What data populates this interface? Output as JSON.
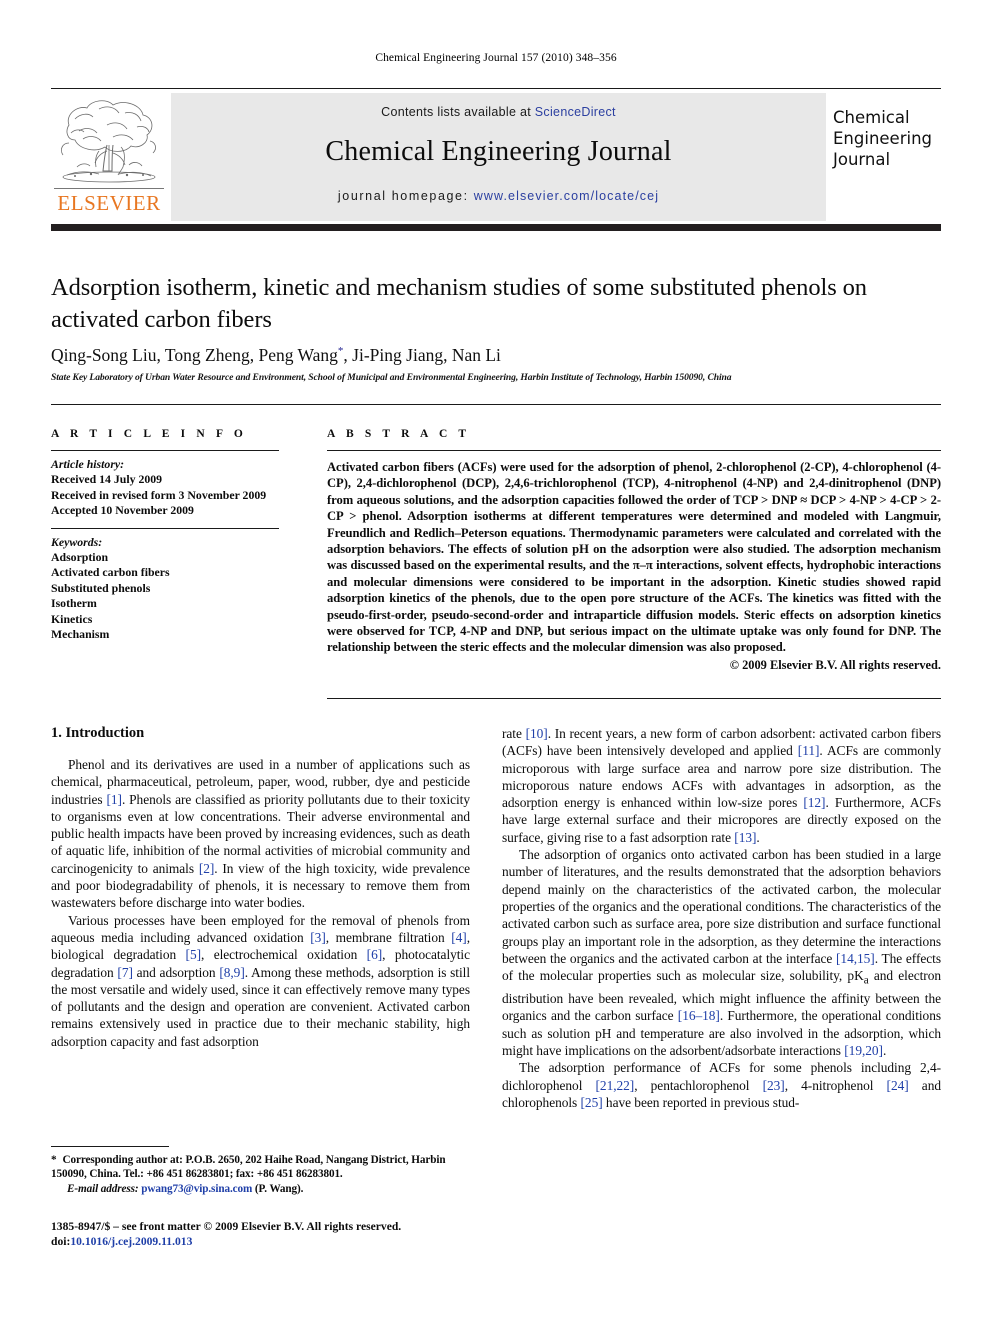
{
  "running_head": "Chemical Engineering Journal 157 (2010) 348–356",
  "masthead": {
    "contents_prefix": "Contents lists available at ",
    "sciencedirect": "ScienceDirect",
    "journal_title": "Chemical Engineering Journal",
    "homepage_prefix": "journal homepage:",
    "homepage_url": "www.elsevier.com/locate/cej",
    "publisher": "ELSEVIER",
    "cover_title": "Chemical\nEngineering\nJournal",
    "cover_line1": "Chemical",
    "cover_line2": "Engineering",
    "cover_line3": "Journal",
    "link_color": "#2b3fa0",
    "elsevier_orange": "#E87722",
    "band_color": "#e8e8e8"
  },
  "article": {
    "title": "Adsorption isotherm, kinetic and mechanism studies of some substituted phenols on activated carbon fibers",
    "authors": "Qing-Song Liu, Tong Zheng, Peng Wang",
    "authors_tail": ", Ji-Ping Jiang, Nan Li",
    "corresponding_marker": "*",
    "affiliation": "State Key Laboratory of Urban Water Resource and Environment, School of Municipal and Environmental Engineering, Harbin Institute of Technology, Harbin 150090, China"
  },
  "article_info": {
    "heading": "A R T I C L E   I N F O",
    "history_label": "Article history:",
    "history": [
      "Received 14 July 2009",
      "Received in revised form 3 November 2009",
      "Accepted 10 November 2009"
    ],
    "keywords_label": "Keywords:",
    "keywords": [
      "Adsorption",
      "Activated carbon fibers",
      "Substituted phenols",
      "Isotherm",
      "Kinetics",
      "Mechanism"
    ]
  },
  "abstract": {
    "heading": "A B S T R A C T",
    "text": "Activated carbon fibers (ACFs) were used for the adsorption of phenol, 2-chlorophenol (2-CP), 4-chlorophenol (4-CP), 2,4-dichlorophenol (DCP), 2,4,6-trichlorophenol (TCP), 4-nitrophenol (4-NP) and 2,4-dinitrophenol (DNP) from aqueous solutions, and the adsorption capacities followed the order of TCP > DNP ≈ DCP > 4-NP > 4-CP > 2-CP > phenol. Adsorption isotherms at different temperatures were determined and modeled with Langmuir, Freundlich and Redlich–Peterson equations. Thermodynamic parameters were calculated and correlated with the adsorption behaviors. The effects of solution pH on the adsorption were also studied. The adsorption mechanism was discussed based on the experimental results, and the π–π interactions, solvent effects, hydrophobic interactions and molecular dimensions were considered to be important in the adsorption. Kinetic studies showed rapid adsorption kinetics of the phenols, due to the open pore structure of the ACFs. The kinetics was fitted with the pseudo-first-order, pseudo-second-order and intraparticle diffusion models. Steric effects on adsorption kinetics were observed for TCP, 4-NP and DNP, but serious impact on the ultimate uptake was only found for DNP. The relationship between the steric effects and the molecular dimension was also proposed.",
    "copyright": "© 2009 Elsevier B.V. All rights reserved."
  },
  "body": {
    "section_heading": "1. Introduction",
    "left_p1_a": "Phenol and its derivatives are used in a number of applications such as chemical, pharmaceutical, petroleum, paper, wood, rubber, dye and pesticide industries ",
    "left_p1_r1": "[1]",
    "left_p1_b": ". Phenols are classified as priority pollutants due to their toxicity to organisms even at low concentrations. Their adverse environmental and public health impacts have been proved by increasing evidences, such as death of aquatic life, inhibition of the normal activities of microbial community and carcinogenicity to animals ",
    "left_p1_r2": "[2]",
    "left_p1_c": ". In view of the high toxicity, wide prevalence and poor biodegradability of phenols, it is necessary to remove them from wastewaters before discharge into water bodies.",
    "left_p2_a": "Various processes have been employed for the removal of phenols from aqueous media including advanced oxidation ",
    "left_p2_r3": "[3]",
    "left_p2_b": ", membrane filtration ",
    "left_p2_r4": "[4]",
    "left_p2_c": ", biological degradation ",
    "left_p2_r5": "[5]",
    "left_p2_d": ", electrochemical oxidation ",
    "left_p2_r6": "[6]",
    "left_p2_e": ", photocatalytic degradation ",
    "left_p2_r7": "[7]",
    "left_p2_f": " and adsorption ",
    "left_p2_r8": "[8,9]",
    "left_p2_g": ". Among these methods, adsorption is still the most versatile and widely used, since it can effectively remove many types of pollutants and the design and operation are convenient. Activated carbon remains extensively used in practice due to their mechanic stability, high adsorption capacity and fast adsorption",
    "right_p1_a": "rate ",
    "right_p1_r10": "[10]",
    "right_p1_b": ". In recent years, a new form of carbon adsorbent: activated carbon fibers (ACFs) have been intensively developed and applied ",
    "right_p1_r11": "[11]",
    "right_p1_c": ". ACFs are commonly microporous with large surface area and narrow pore size distribution. The microporous nature endows ACFs with advantages in adsorption, as the adsorption energy is enhanced within low-size pores ",
    "right_p1_r12": "[12]",
    "right_p1_d": ". Furthermore, ACFs have large external surface and their micropores are directly exposed on the surface, giving rise to a fast adsorption rate ",
    "right_p1_r13": "[13]",
    "right_p1_e": ".",
    "right_p2_a": "The adsorption of organics onto activated carbon has been studied in a large number of literatures, and the results demonstrated that the adsorption behaviors depend mainly on the characteristics of the activated carbon, the molecular properties of the organics and the operational conditions. The characteristics of the activated carbon such as surface area, pore size distribution and surface functional groups play an important role in the adsorption, as they determine the interactions between the organics and the activated carbon at the interface ",
    "right_p2_r14": "[14,15]",
    "right_p2_b": ". The effects of the molecular properties such as molecular size, solubility, pK",
    "right_p2_sub": "a",
    "right_p2_c": " and electron distribution have been revealed, which might influence the affinity between the organics and the carbon surface ",
    "right_p2_r16": "[16–18]",
    "right_p2_d": ". Furthermore, the operational conditions such as solution pH and temperature are also involved in the adsorption, which might have implications on the adsorbent/adsorbate interactions ",
    "right_p2_r19": "[19,20]",
    "right_p2_e": ".",
    "right_p3_a": "The adsorption performance of ACFs for some phenols including 2,4-dichlorophenol ",
    "right_p3_r21": "[21,22]",
    "right_p3_b": ", pentachlorophenol ",
    "right_p3_r23": "[23]",
    "right_p3_c": ", 4-nitrophenol ",
    "right_p3_r24": "[24]",
    "right_p3_d": " and chlorophenols ",
    "right_p3_r25": "[25]",
    "right_p3_e": " have been reported in previous stud-"
  },
  "footer": {
    "corr_marker": "*",
    "corr_text": "Corresponding author at: P.O.B. 2650, 202 Haihe Road, Nangang District, Harbin 150090, China. Tel.: +86 451 86283801; fax: +86 451 86283801.",
    "email_label": "E-mail address:",
    "email": "pwang73@vip.sina.com",
    "email_tail": "(P. Wang).",
    "issn_line": "1385-8947/$ – see front matter © 2009 Elsevier B.V. All rights reserved.",
    "doi_label": "doi:",
    "doi": "10.1016/j.cej.2009.11.013"
  }
}
